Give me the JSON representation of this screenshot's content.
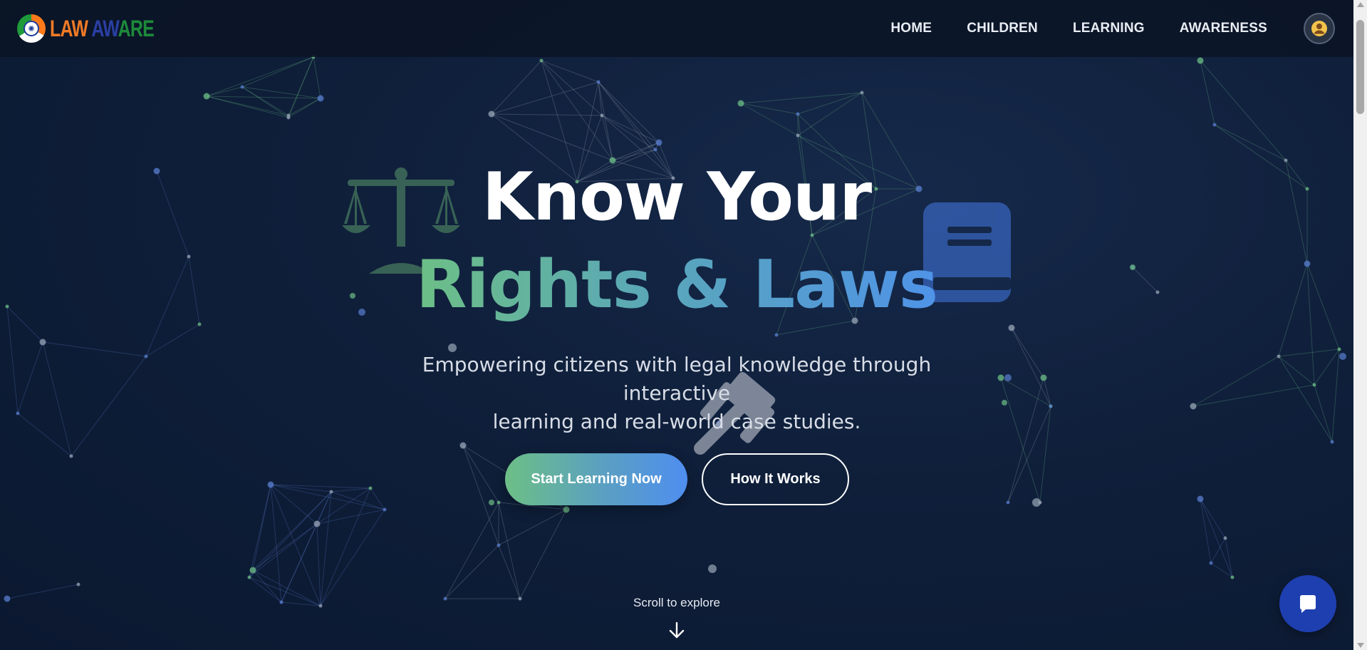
{
  "header": {
    "logo": {
      "part1": "LAW",
      "part2": " AW",
      "part3": "ARE"
    },
    "nav": [
      {
        "label": "HOME"
      },
      {
        "label": "CHILDREN"
      },
      {
        "label": "LEARNING"
      },
      {
        "label": "AWARENESS"
      }
    ]
  },
  "hero": {
    "title_line1": "Know Your",
    "title_line2": "Rights & Laws",
    "subtitle_line1": "Empowering citizens with legal knowledge through interactive",
    "subtitle_line2": "learning and real-world case studies.",
    "primary_button": "Start Learning Now",
    "secondary_button": "How It Works",
    "scroll_label": "Scroll to explore"
  },
  "icons": {
    "user": "user-icon",
    "scales": "scales-of-justice-icon",
    "book": "book-icon",
    "gavel": "gavel-icon",
    "chat": "chat-icon",
    "arrow": "arrow-down-icon"
  },
  "colors": {
    "background": "#0f1f3a",
    "gradient_start": "#6dbf86",
    "gradient_end": "#4f8ef0",
    "logo_orange": "#f07a26",
    "logo_blue": "#2a3fa4",
    "logo_green": "#1d8a3a",
    "chat_button": "#1e3fb0"
  }
}
